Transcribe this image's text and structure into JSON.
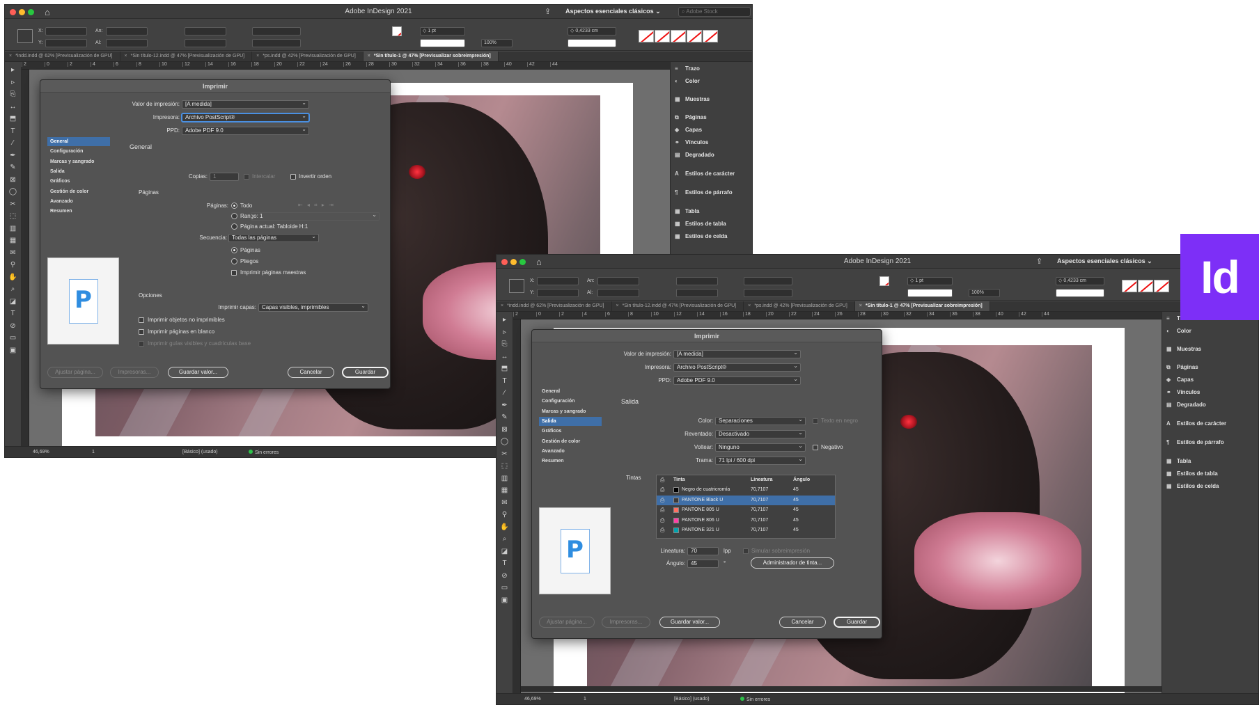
{
  "app_title": "Adobe InDesign 2021",
  "workspace": "Aspectos esenciales clásicos",
  "search_placeholder": "Adobe Stock",
  "logo_text": "Id",
  "control_bar": {
    "x_label": "X:",
    "y_label": "Y:",
    "w_label": "An:",
    "h_label": "Al:",
    "stroke_weight": "1 pt",
    "zoom_pct": "100%",
    "offset_value": "0,4233 cm"
  },
  "doc_tabs": [
    {
      "label": "*indd.indd @ 62% [Previsualización de GPU]",
      "active": false
    },
    {
      "label": "*Sin título-12.indd @ 47% [Previsualización de GPU]",
      "active": false
    },
    {
      "label": "*ps.indd @ 42% [Previsualización de GPU]",
      "active": false
    },
    {
      "label": "*Sin título-1 @ 47% [Previsualizar sobreimpresión]",
      "active": true
    }
  ],
  "ruler_ticks": [
    "2",
    "0",
    "2",
    "4",
    "6",
    "8",
    "10",
    "12",
    "14",
    "16",
    "18",
    "20",
    "22",
    "24",
    "26",
    "28",
    "30",
    "32",
    "34",
    "36",
    "38",
    "40",
    "42",
    "44"
  ],
  "panels": [
    {
      "icon": "≡",
      "label": "Trazo"
    },
    {
      "icon": "◐",
      "label": "Color"
    },
    {
      "icon": "▦",
      "label": "Muestras"
    },
    {
      "icon": "⧉",
      "label": "Páginas"
    },
    {
      "icon": "◈",
      "label": "Capas"
    },
    {
      "icon": "⚭",
      "label": "Vínculos"
    },
    {
      "icon": "▤",
      "label": "Degradado"
    },
    {
      "icon": "A",
      "label": "Estilos de carácter"
    },
    {
      "icon": "¶",
      "label": "Estilos de párrafo"
    },
    {
      "icon": "▦",
      "label": "Tabla"
    },
    {
      "icon": "▦",
      "label": "Estilos de tabla"
    },
    {
      "icon": "▦",
      "label": "Estilos de celda"
    }
  ],
  "status_bar": {
    "zoom": "46,69%",
    "page": "1",
    "style": "[Básico] (usado)",
    "errors": "Sin errores"
  },
  "dialog": {
    "title": "Imprimir",
    "preset_label": "Valor de impresión:",
    "preset_value": "[A medida]",
    "printer_label": "Impresora:",
    "printer_value": "Archivo PostScript®",
    "ppd_label": "PPD:",
    "ppd_value": "Adobe PDF 9.0",
    "nav": [
      "General",
      "Configuración",
      "Marcas y sangrado",
      "Salida",
      "Gráficos",
      "Gestión de color",
      "Avanzado",
      "Resumen"
    ],
    "thumb_glyph": "P",
    "btn_setup": "Ajustar página...",
    "btn_printers": "Impresoras...",
    "btn_save_preset": "Guardar valor...",
    "btn_cancel": "Cancelar",
    "btn_save": "Guardar"
  },
  "general": {
    "heading": "General",
    "copies_label": "Copias:",
    "copies_value": "1",
    "collate": "Intercalar",
    "reverse": "Invertir orden",
    "pages_section": "Páginas",
    "pages_label": "Páginas:",
    "all": "Todo",
    "range_label": "Rango:",
    "range_value": "1",
    "current_page": "Página actual: Tabloide H:1",
    "sequence_label": "Secuencia:",
    "sequence_value": "Todas las páginas",
    "opt_pages": "Páginas",
    "opt_spreads": "Pliegos",
    "print_masters": "Imprimir páginas maestras",
    "options_section": "Opciones",
    "layers_label": "Imprimir capas:",
    "layers_value": "Capas visibles, imprimibles",
    "nonprinting": "Imprimir objetos no imprimibles",
    "blank_pages": "Imprimir páginas en blanco",
    "guides": "Imprimir guías visibles y cuadrículas base"
  },
  "output": {
    "heading": "Salida",
    "color_label": "Color:",
    "color_value": "Separaciones",
    "text_black": "Texto en negro",
    "trap_label": "Reventado:",
    "trap_value": "Desactivado",
    "flip_label": "Voltear:",
    "flip_value": "Ninguno",
    "negative": "Negativo",
    "screen_label": "Trama:",
    "screen_value": "71 lpi / 600 dpi",
    "inks_section": "Tintas",
    "col_ink": "Tinta",
    "col_freq": "Lineatura",
    "col_angle": "Ángulo",
    "inks": [
      {
        "name": "Negro de cuatricromía",
        "freq": "70,7107",
        "angle": "45",
        "color": "#000000"
      },
      {
        "name": "PANTONE Black U",
        "freq": "70,7107",
        "angle": "45",
        "color": "#3a3a3a"
      },
      {
        "name": "PANTONE 805 U",
        "freq": "70,7107",
        "angle": "45",
        "color": "#ff6f61"
      },
      {
        "name": "PANTONE 806 U",
        "freq": "70,7107",
        "angle": "45",
        "color": "#ff3fa4"
      },
      {
        "name": "PANTONE 321 U",
        "freq": "70,7107",
        "angle": "45",
        "color": "#00a3ad"
      }
    ],
    "freq_label": "Lineatura:",
    "freq_value": "70",
    "freq_unit": "lpp",
    "simulate": "Simular sobreimpresión",
    "angle_label": "Ángulo:",
    "angle_value": "45",
    "angle_unit": "°",
    "ink_manager": "Administrador de tinta..."
  }
}
